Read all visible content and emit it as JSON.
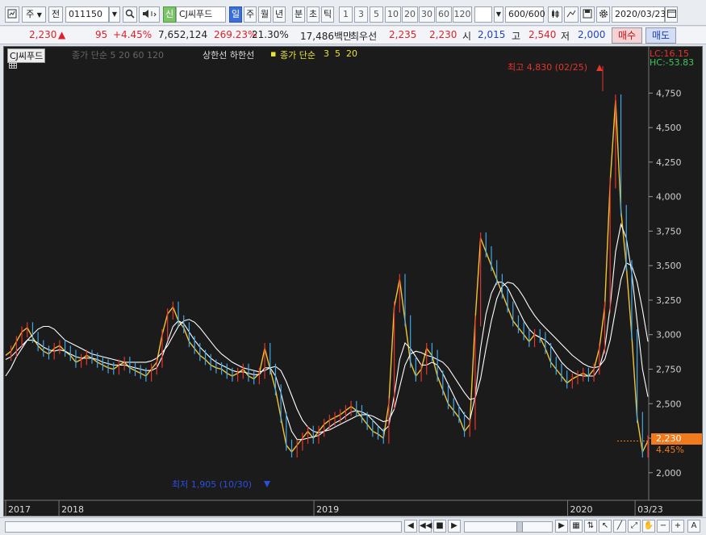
{
  "toolbar": {
    "period_label": "주",
    "prev_label": "전",
    "code": "011150",
    "shin_label": "신",
    "stock_name": "CJ씨푸드",
    "tabs": [
      "일",
      "주",
      "월",
      "년",
      "분",
      "초",
      "틱"
    ],
    "active_tab": 0,
    "intervals": [
      "1",
      "3",
      "5",
      "10",
      "20",
      "30",
      "60",
      "120"
    ],
    "count": "600/600",
    "date": "2020/03/23"
  },
  "quote": {
    "price": "2,230",
    "change": "95",
    "change_pct": "+4.45%",
    "volume": "7,652,124",
    "vol_ratio": "269.23%",
    "turnover": "21.30%",
    "amount": "17,486백만",
    "best_label": "최우선",
    "best_ask": "2,235",
    "best_bid": "2,230",
    "open_label": "시",
    "open": "2,015",
    "high_label": "고",
    "high": "2,540",
    "low_label": "저",
    "low": "2,000",
    "buy_label": "매수",
    "sell_label": "매도"
  },
  "legend": {
    "name": "CJ씨푸드",
    "ma_text": "종가 단순 5 20 60 120",
    "band_text": "상한선 하한선",
    "ma2_text": "종가 단순",
    "ma2_vals": [
      "3",
      "5",
      "20"
    ],
    "lc": "LC:16.15",
    "hc": "HC:-53.83"
  },
  "annotations": {
    "max": "최고 4,830 (02/25)",
    "min": "최저 1,905 (10/30)"
  },
  "price_tag": {
    "value": "2,230",
    "pct": "4.45%"
  },
  "chart_data": {
    "type": "line",
    "y_ticks": [
      2000,
      2250,
      2500,
      2750,
      3000,
      3250,
      3500,
      3750,
      4000,
      4250,
      4500,
      4750
    ],
    "y_tick_labels": [
      "2,000",
      "2,250",
      "2,500",
      "2,750",
      "3,000",
      "3,250",
      "3,500",
      "3,750",
      "4,000",
      "4,250",
      "4,500",
      "4,750"
    ],
    "ylim": [
      1800,
      4980
    ],
    "x_labels": [
      {
        "t": 0.0,
        "label": "2017"
      },
      {
        "t": 0.083,
        "label": "2018"
      },
      {
        "t": 0.48,
        "label": "2019"
      },
      {
        "t": 0.875,
        "label": "2020"
      },
      {
        "t": 0.98,
        "label": "03/23"
      }
    ],
    "series": [
      {
        "values": [
          2850,
          2880,
          2950,
          3020,
          3050,
          2980,
          2920,
          2880,
          2860,
          2900,
          2920,
          2880,
          2850,
          2800,
          2820,
          2850,
          2830,
          2800,
          2780,
          2760,
          2750,
          2780,
          2800,
          2760,
          2740,
          2720,
          2700,
          2750,
          2800,
          3000,
          3150,
          3200,
          3100,
          3050,
          2950,
          2900,
          2850,
          2820,
          2780,
          2760,
          2750,
          2720,
          2700,
          2720,
          2750,
          2700,
          2680,
          2720,
          2900,
          2750,
          2600,
          2400,
          2200,
          2150,
          2200,
          2250,
          2300,
          2250,
          2300,
          2350,
          2380,
          2400,
          2420,
          2450,
          2480,
          2450,
          2400,
          2350,
          2300,
          2280,
          2250,
          2500,
          3200,
          3400,
          3100,
          2800,
          2700,
          2750,
          2900,
          2850,
          2700,
          2600,
          2500,
          2450,
          2400,
          2300,
          2350,
          3100,
          3700,
          3600,
          3500,
          3400,
          3300,
          3200,
          3100,
          3050,
          3000,
          2950,
          3000,
          2980,
          2900,
          2800,
          2750,
          2700,
          2650,
          2680,
          2700,
          2720,
          2700,
          2750,
          2900,
          3200,
          4100,
          4700,
          3900,
          3500,
          3000,
          2400,
          2150,
          2230
        ]
      },
      {
        "values": [
          2820,
          2840,
          2880,
          2920,
          2960,
          2960,
          2940,
          2910,
          2890,
          2880,
          2890,
          2880,
          2860,
          2840,
          2830,
          2830,
          2830,
          2820,
          2800,
          2790,
          2780,
          2780,
          2780,
          2770,
          2760,
          2750,
          2740,
          2740,
          2760,
          2840,
          2950,
          3060,
          3100,
          3080,
          3020,
          2960,
          2910,
          2870,
          2830,
          2800,
          2780,
          2760,
          2740,
          2730,
          2730,
          2720,
          2710,
          2710,
          2760,
          2760,
          2700,
          2580,
          2420,
          2300,
          2240,
          2240,
          2250,
          2260,
          2270,
          2300,
          2330,
          2360,
          2380,
          2410,
          2440,
          2450,
          2440,
          2420,
          2380,
          2340,
          2300,
          2340,
          2560,
          2820,
          2940,
          2900,
          2840,
          2780,
          2780,
          2800,
          2780,
          2720,
          2640,
          2560,
          2480,
          2420,
          2380,
          2550,
          2900,
          3150,
          3300,
          3380,
          3380,
          3340,
          3260,
          3180,
          3100,
          3040,
          3000,
          2980,
          2960,
          2920,
          2860,
          2800,
          2760,
          2730,
          2710,
          2700,
          2700,
          2700,
          2760,
          2900,
          3200,
          3600,
          3800,
          3700,
          3450,
          3100,
          2750,
          2550
        ]
      },
      {
        "values": [
          2700,
          2760,
          2840,
          2900,
          2960,
          3000,
          3040,
          3060,
          3060,
          3040,
          3000,
          2960,
          2940,
          2920,
          2900,
          2880,
          2860,
          2850,
          2840,
          2830,
          2820,
          2810,
          2800,
          2800,
          2800,
          2800,
          2800,
          2810,
          2830,
          2870,
          2920,
          2990,
          3060,
          3100,
          3110,
          3090,
          3050,
          3000,
          2950,
          2900,
          2860,
          2830,
          2800,
          2780,
          2760,
          2750,
          2740,
          2730,
          2740,
          2760,
          2770,
          2740,
          2660,
          2560,
          2460,
          2380,
          2330,
          2300,
          2290,
          2300,
          2310,
          2330,
          2350,
          2370,
          2390,
          2410,
          2420,
          2420,
          2410,
          2390,
          2370,
          2380,
          2460,
          2620,
          2780,
          2860,
          2880,
          2870,
          2850,
          2840,
          2820,
          2800,
          2760,
          2700,
          2640,
          2580,
          2530,
          2540,
          2680,
          2900,
          3100,
          3260,
          3350,
          3380,
          3370,
          3330,
          3270,
          3200,
          3140,
          3090,
          3050,
          3010,
          2970,
          2930,
          2890,
          2850,
          2820,
          2790,
          2770,
          2760,
          2770,
          2820,
          2960,
          3180,
          3400,
          3520,
          3500,
          3380,
          3180,
          2950
        ]
      }
    ]
  }
}
